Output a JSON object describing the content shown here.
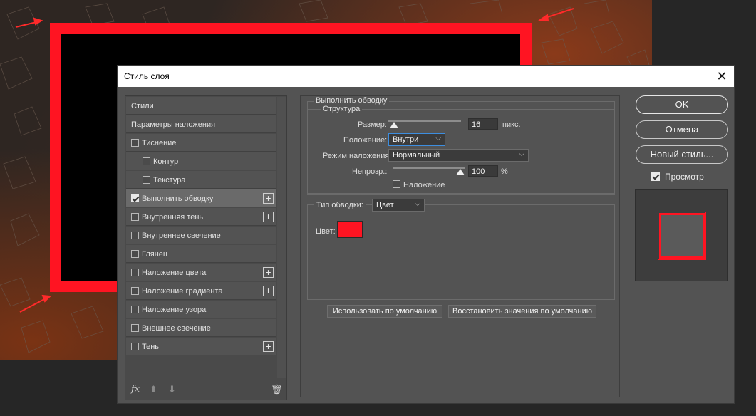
{
  "dialog": {
    "title": "Стиль слоя",
    "close_glyph": "✕"
  },
  "style_list": {
    "items": [
      {
        "label": "Стили",
        "checkbox": false,
        "checked": false,
        "plus": false
      },
      {
        "label": "Параметры наложения",
        "checkbox": false,
        "checked": false,
        "plus": false
      },
      {
        "label": "Тиснение",
        "checkbox": true,
        "checked": false,
        "plus": false
      },
      {
        "label": "Контур",
        "checkbox": true,
        "checked": false,
        "plus": false
      },
      {
        "label": "Текстура",
        "checkbox": true,
        "checked": false,
        "plus": false
      },
      {
        "label": "Выполнить обводку",
        "checkbox": true,
        "checked": true,
        "plus": true
      },
      {
        "label": "Внутренняя тень",
        "checkbox": true,
        "checked": false,
        "plus": true
      },
      {
        "label": "Внутреннее свечение",
        "checkbox": true,
        "checked": false,
        "plus": false
      },
      {
        "label": "Глянец",
        "checkbox": true,
        "checked": false,
        "plus": false
      },
      {
        "label": "Наложение цвета",
        "checkbox": true,
        "checked": false,
        "plus": true
      },
      {
        "label": "Наложение градиента",
        "checkbox": true,
        "checked": false,
        "plus": true
      },
      {
        "label": "Наложение узора",
        "checkbox": true,
        "checked": false,
        "plus": false
      },
      {
        "label": "Внешнее свечение",
        "checkbox": true,
        "checked": false,
        "plus": false
      },
      {
        "label": "Тень",
        "checkbox": true,
        "checked": false,
        "plus": true
      }
    ],
    "bottom_icons": {
      "fx": "fx",
      "up": "⬆",
      "down": "⬇",
      "trash": "🗑"
    }
  },
  "stroke": {
    "section_title": "Выполнить обводку",
    "structure_title": "Структура",
    "size_label": "Размер:",
    "size_value": "16",
    "size_unit": "пикс.",
    "position_label": "Положение:",
    "position_value": "Внутри",
    "blend_label": "Режим наложения:",
    "blend_value": "Нормальный",
    "opacity_label": "Непрозр.:",
    "opacity_value": "100",
    "opacity_unit": "%",
    "opacity_level": 100,
    "overprint_label": "Наложение",
    "fill_type_label": "Тип обводки:",
    "fill_type_value": "Цвет",
    "color_label": "Цвет:",
    "color_hex": "#ff1422",
    "make_default": "Использовать по умолчанию",
    "reset_default": "Восстановить значения по умолчанию"
  },
  "buttons": {
    "ok": "OK",
    "cancel": "Отмена",
    "new_style": "Новый стиль...",
    "preview_label": "Просмотр"
  },
  "colors": {
    "accent_red": "#ff1422",
    "dialog_bg": "#535353",
    "focus_blue": "#3d8ee0"
  }
}
